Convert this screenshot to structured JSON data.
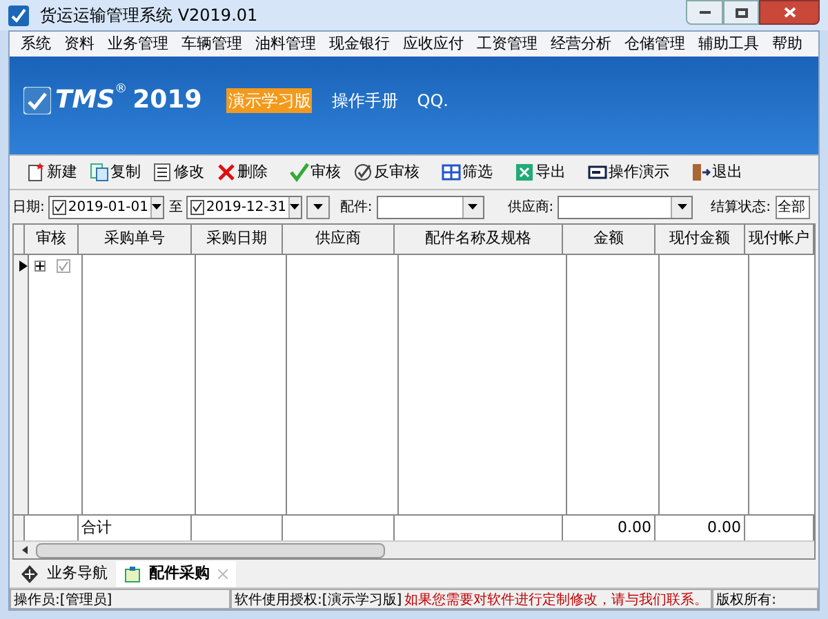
{
  "window": {
    "title": "货运运输管理系统 V2019.01"
  },
  "menu": [
    "系统",
    "资料",
    "业务管理",
    "车辆管理",
    "油料管理",
    "现金银行",
    "应收应付",
    "工资管理",
    "经营分析",
    "仓储管理",
    "辅助工具",
    "帮助"
  ],
  "banner": {
    "logo": "TMS",
    "logo_mark": "®",
    "logo_year": "2019",
    "edition": "演示学习版",
    "links": [
      "操作手册",
      "QQ."
    ]
  },
  "toolbar": [
    {
      "kind": "new",
      "label": "新建"
    },
    {
      "kind": "copy",
      "label": "复制"
    },
    {
      "kind": "edit",
      "label": "修改"
    },
    {
      "kind": "delete",
      "label": "删除"
    },
    {
      "kind": "approve",
      "label": "审核"
    },
    {
      "kind": "unapprove",
      "label": "反审核"
    },
    {
      "kind": "filter",
      "label": "筛选"
    },
    {
      "kind": "export",
      "label": "导出"
    },
    {
      "kind": "demo",
      "label": "操作演示"
    },
    {
      "kind": "exit",
      "label": "退出"
    }
  ],
  "filters": {
    "date_label": "日期:",
    "date_from": {
      "checked": true,
      "value": "2019-01-01"
    },
    "to_label": "至",
    "date_to": {
      "checked": true,
      "value": "2019-12-31"
    },
    "part_label": "配件:",
    "supplier_label": "供应商:",
    "status_label": "结算状态:",
    "status_value": "全部"
  },
  "table": {
    "columns": [
      "审核",
      "采购单号",
      "采购日期",
      "供应商",
      "配件名称及规格",
      "金额",
      "现付金额",
      "现付帐户"
    ],
    "rows": [
      {
        "expanded": false,
        "checked": true
      }
    ],
    "total": {
      "label": "合计",
      "amount": "0.00",
      "paid": "0.00"
    }
  },
  "tabs": [
    {
      "label": "业务导航",
      "selected": false
    },
    {
      "label": "配件采购",
      "selected": true
    }
  ],
  "status_bar": {
    "operator": "操作员:[管理员]",
    "license": "软件使用授权:[演示学习版]",
    "notice": "如果您需要对软件进行定制修改，请与我们联系。",
    "copyright": "版权所有:"
  }
}
